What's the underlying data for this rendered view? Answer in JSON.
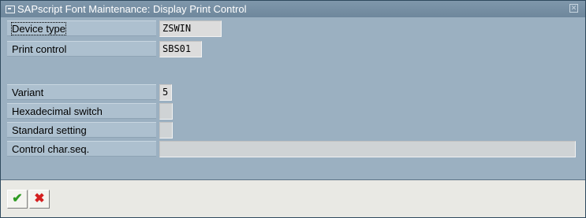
{
  "window": {
    "title": "SAPscript Font Maintenance: Display Print Control"
  },
  "fields": {
    "device_type": {
      "label": "Device type",
      "value": "ZSWIN"
    },
    "print_control": {
      "label": "Print control",
      "value": "SBS01"
    },
    "variant": {
      "label": "Variant",
      "value": "5"
    },
    "hex_switch": {
      "label": "Hexadecimal switch",
      "value": ""
    },
    "standard_setting": {
      "label": "Standard setting",
      "value": ""
    },
    "control_char_seq": {
      "label": "Control char.seq.",
      "value": ""
    }
  },
  "footer": {
    "continue_icon": "checkmark-icon",
    "cancel_icon": "cancel-x-icon"
  },
  "colors": {
    "background": "#9bb0c1",
    "titlebar": "#7089a0",
    "field": "#dcdcdc",
    "footer": "#e9e9e4"
  }
}
